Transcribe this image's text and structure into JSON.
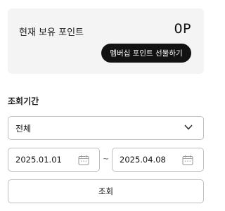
{
  "points": {
    "label": "현재 보유 포인트",
    "value": "0P",
    "gift_button": "멤버십 포인트 선물하기"
  },
  "period": {
    "label": "조회기간",
    "selected": "전체",
    "start_date": "2025.01.01",
    "end_date": "2025.04.08",
    "separator": "~"
  },
  "search_button": "조회",
  "icons": {
    "dropdown": "chevron-down-icon",
    "date": "calendar-icon"
  }
}
